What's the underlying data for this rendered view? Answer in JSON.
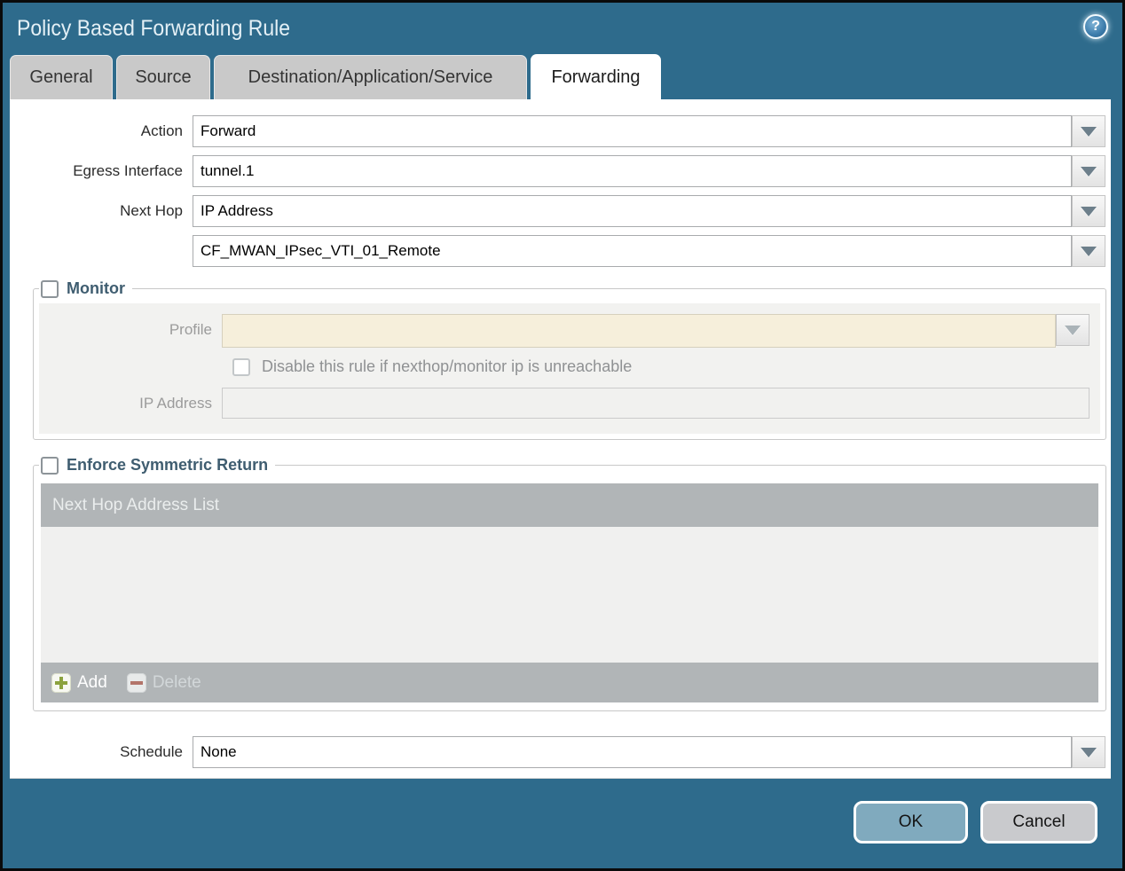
{
  "dialog": {
    "title": "Policy Based Forwarding Rule"
  },
  "tabs": [
    {
      "label": "General",
      "active": false
    },
    {
      "label": "Source",
      "active": false
    },
    {
      "label": "Destination/Application/Service",
      "active": false
    },
    {
      "label": "Forwarding",
      "active": true
    }
  ],
  "form": {
    "action": {
      "label": "Action",
      "value": "Forward"
    },
    "egress_interface": {
      "label": "Egress Interface",
      "value": "tunnel.1"
    },
    "next_hop": {
      "label": "Next Hop",
      "value": "IP Address"
    },
    "next_hop_address": {
      "value": "CF_MWAN_IPsec_VTI_01_Remote"
    },
    "schedule": {
      "label": "Schedule",
      "value": "None"
    }
  },
  "monitor": {
    "legend": "Monitor",
    "checked": false,
    "profile": {
      "label": "Profile",
      "value": ""
    },
    "disable_rule": {
      "label": "Disable this rule if nexthop/monitor ip is unreachable",
      "checked": false
    },
    "ip_address": {
      "label": "IP Address",
      "value": ""
    }
  },
  "symmetric_return": {
    "legend": "Enforce Symmetric Return",
    "checked": false,
    "table": {
      "header": "Next Hop Address List",
      "rows": []
    },
    "add_label": "Add",
    "delete_label": "Delete",
    "delete_enabled": false
  },
  "footer": {
    "ok_label": "OK",
    "cancel_label": "Cancel"
  },
  "icons": {
    "help": "help-icon",
    "dropdown": "chevron-down-icon",
    "add": "plus-icon",
    "delete": "minus-icon"
  },
  "colors": {
    "frame_teal": "#2e6b8c",
    "tab_inactive": "#c9c9c9",
    "grid_gray": "#b1b5b7",
    "disabled_field_cream": "#f6efdb",
    "panel_gray": "#f2f2f0",
    "ok_button": "#80aabe",
    "cancel_button": "#c9cacd",
    "add_green": "#8ba23e",
    "delete_red": "#b3746a"
  }
}
